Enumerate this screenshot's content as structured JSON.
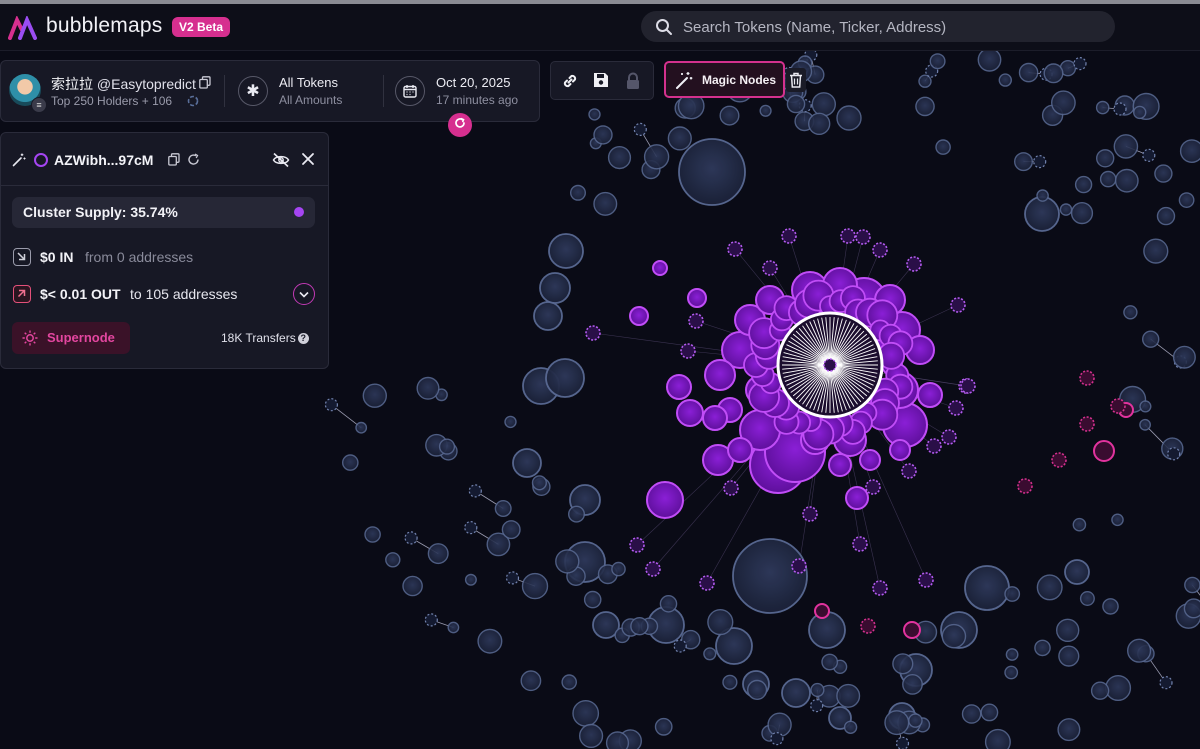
{
  "app": {
    "brand": "bubblemaps",
    "badge": "V2 Beta",
    "search_placeholder": "Search Tokens (Name, Ticker, Address)"
  },
  "infobar": {
    "user_name": "索拉拉",
    "user_handle": "@Easytopredict",
    "holders": "Top 250 Holders + 106",
    "tokens_label": "All Tokens",
    "tokens_sub": "All Amounts",
    "date": "Oct 20, 2025",
    "date_sub": "17 minutes ago"
  },
  "toolbar": {
    "magic_nodes": "Magic Nodes"
  },
  "detail": {
    "address": "AZWibh...97cM",
    "cluster_supply": "Cluster Supply: 35.74%",
    "in_amount": "$0 IN",
    "in_text": "from 0 addresses",
    "out_amount": "$< 0.01 OUT",
    "out_text": "to 105 addresses",
    "supernode": "Supernode",
    "transfers": "18K Transfers"
  },
  "colors": {
    "accent": "#d62f8f",
    "cluster_purple": "#a545f2",
    "bubble_blue": "#2a3352",
    "bubble_magenta": "#d4318e",
    "background": "#0a0b16"
  },
  "icons": [
    "logo-icon",
    "search-icon",
    "copy-icon",
    "spinner-icon",
    "asterisk-icon",
    "calendar-icon",
    "refresh-icon",
    "link-icon",
    "save-icon",
    "lock-icon",
    "magic-wand-icon",
    "trash-icon",
    "eye-off-icon",
    "close-icon",
    "arrow-in-icon",
    "arrow-out-icon",
    "chevron-down-icon",
    "sun-icon",
    "help-icon"
  ]
}
